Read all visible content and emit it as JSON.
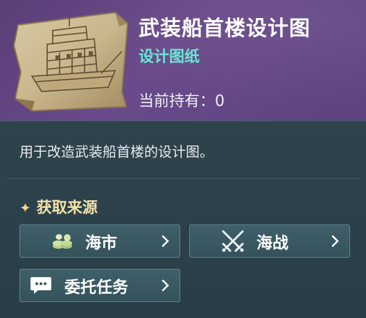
{
  "item": {
    "name": "武装船首楼设计图",
    "category": "设计图纸",
    "owned_label": "当前持有：",
    "owned_count": "0",
    "description": "用于改造武装船首楼的设计图。"
  },
  "sources": {
    "title": "获取来源",
    "buttons": [
      {
        "label": "海市",
        "icon": "coins-icon"
      },
      {
        "label": "海战",
        "icon": "crossed-swords-icon"
      },
      {
        "label": "委托任务",
        "icon": "chat-bubble-icon"
      }
    ]
  },
  "colors": {
    "header_bg": "#6a4a8a",
    "subtitle": "#63e7d3",
    "source_title": "#f3e2a8",
    "button_bg": "#3f6069"
  }
}
